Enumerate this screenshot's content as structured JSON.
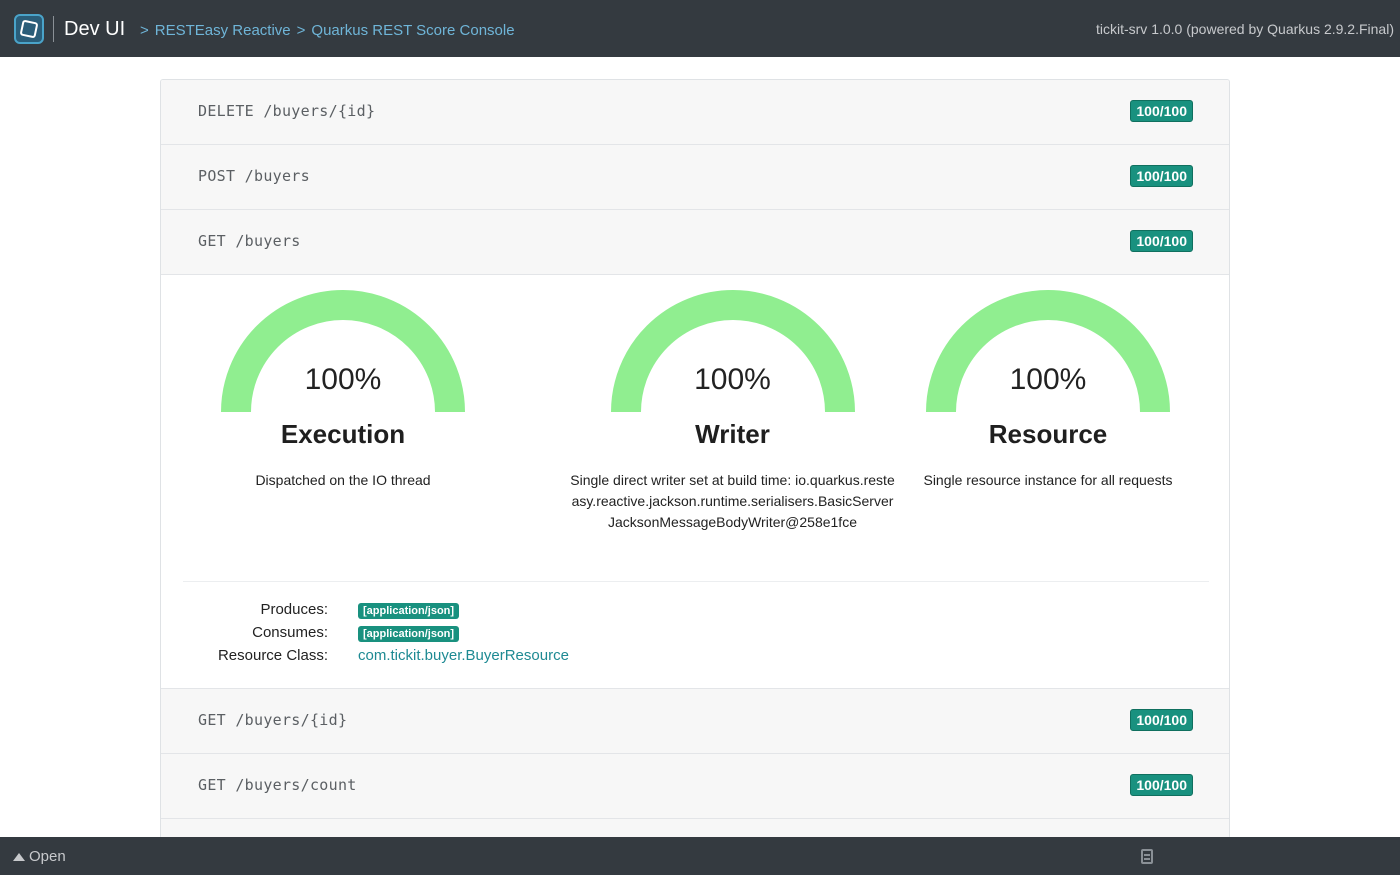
{
  "header": {
    "app_title": "Dev UI",
    "breadcrumb": [
      "RESTEasy Reactive",
      "Quarkus REST Score Console"
    ],
    "breadcrumb_sep": ">",
    "version": "tickit-srv 1.0.0 (powered by Quarkus 2.9.2.Final)"
  },
  "endpoints": [
    {
      "method_path": "DELETE /buyers/{id}",
      "score": "100/100"
    },
    {
      "method_path": "POST /buyers",
      "score": "100/100"
    },
    {
      "method_path": "GET /buyers",
      "score": "100/100"
    },
    {
      "method_path": "GET /buyers/{id}",
      "score": "100/100"
    },
    {
      "method_path": "GET /buyers/count",
      "score": "100/100"
    }
  ],
  "detail": {
    "gauges": [
      {
        "value": 100,
        "label": "100%",
        "title": "Execution",
        "desc": "Dispatched on the IO thread"
      },
      {
        "value": 100,
        "label": "100%",
        "title": "Writer",
        "desc": "Single direct writer set at build time: io.quarkus.resteasy.reactive.jackson.runtime.serialisers.BasicServerJacksonMessageBodyWriter@258e1fce"
      },
      {
        "value": 100,
        "label": "100%",
        "title": "Resource",
        "desc": "Single resource instance for all requests"
      }
    ],
    "produces_label": "Produces:",
    "produces": "[application/json]",
    "consumes_label": "Consumes:",
    "consumes": "[application/json]",
    "resource_class_label": "Resource Class:",
    "resource_class": "com.tickit.buyer.BuyerResource"
  },
  "footer": {
    "open_label": "Open"
  },
  "colors": {
    "nav_bg": "#343a40",
    "accent": "#19917f",
    "gauge_fill": "#90ee90",
    "link": "#1e8a93"
  }
}
